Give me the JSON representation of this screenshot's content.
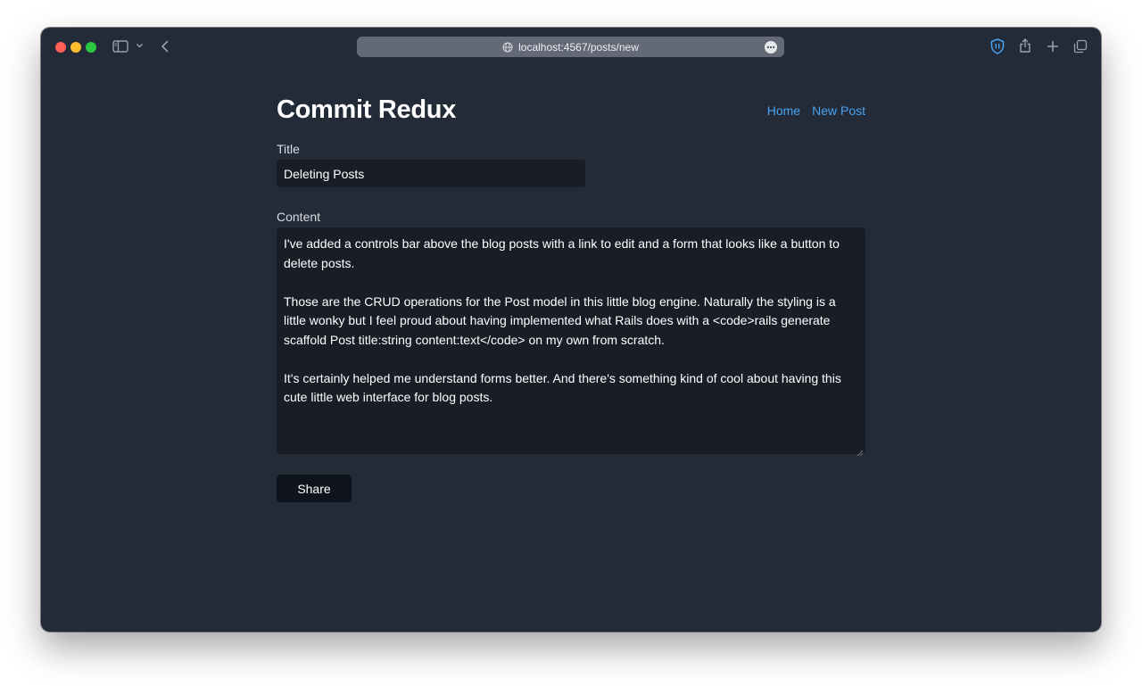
{
  "browser": {
    "url": "localhost:4567/posts/new",
    "colors": {
      "window_bg": "#232a38",
      "url_bar": "#636976"
    },
    "icons": [
      "sidebar-icon",
      "chevron-down-icon",
      "back-icon",
      "globe-icon",
      "more-icon",
      "shield-icon",
      "share-icon",
      "plus-icon",
      "tabs-icon"
    ]
  },
  "site": {
    "title": "Commit Redux",
    "nav": [
      {
        "label": "Home"
      },
      {
        "label": "New Post"
      }
    ],
    "link_color": "#4aa3f0"
  },
  "form": {
    "title_label": "Title",
    "title_value": "Deleting Posts",
    "content_label": "Content",
    "content_value": "I've added a controls bar above the blog posts with a link to edit and a form that looks like a button to delete posts.\n\nThose are the CRUD operations for the Post model in this little blog engine. Naturally the styling is a little wonky but I feel proud about having implemented what Rails does with a <code>rails generate scaffold Post title:string content:text</code> on my own from scratch.\n\nIt's certainly helped me understand forms better. And there's something kind of cool about having this cute little web interface for blog posts.",
    "submit_label": "Share"
  }
}
